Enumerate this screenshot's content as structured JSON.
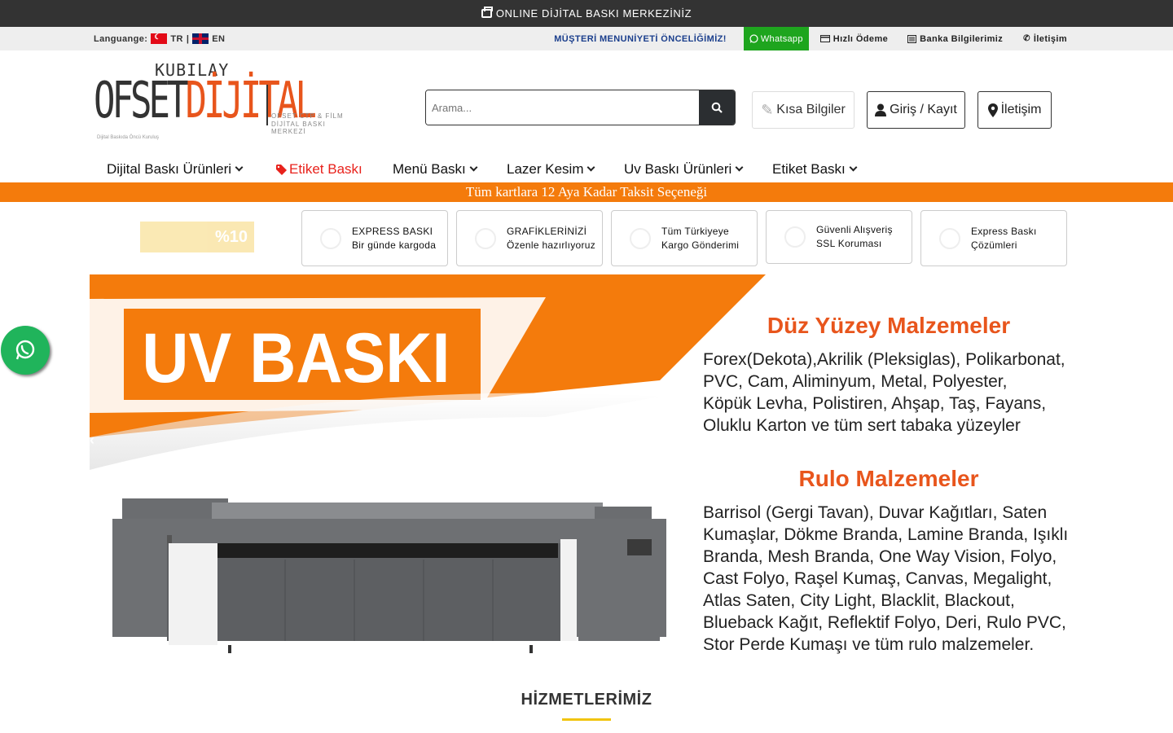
{
  "topbar": {
    "text": "ONLINE DİJİTAL BASKI MERKEZİNİZ",
    "icon": "printer-icon"
  },
  "subbar": {
    "language_label": "Languange:",
    "lang_tr": "TR",
    "lang_sep": "|",
    "lang_en": "EN",
    "slogan": "MÜŞTERİ MENUNİYETİ ÖNCELİĞİMİZ!",
    "whatsapp": "Whatsapp",
    "fast_pay": "Hızlı Ödeme",
    "bank": "Banka Bilgilerimiz",
    "contact": "İletişim"
  },
  "logo": {
    "top": "KUBILAY",
    "main_a": "OFSET",
    "main_b": "DİJİTAL",
    "sub1": "OFSET CTP & FİLM",
    "sub2": "DİJİTAL BASKI MERKEZİ",
    "tagline": "Dijital Baskıda Öncü Kuruluş"
  },
  "search": {
    "placeholder": "Arama..."
  },
  "header_buttons": {
    "info": "Kısa Bilgiler",
    "login": "Giriş / Kayıt",
    "contact": "İletişim"
  },
  "nav": [
    {
      "label": "Dijital Baskı Ürünleri"
    },
    {
      "label": "Etiket Baskı"
    },
    {
      "label": "Menü Baskı"
    },
    {
      "label": "Lazer Kesim"
    },
    {
      "label": "Uv Baskı Ürünleri"
    },
    {
      "label": "Etiket Baskı"
    }
  ],
  "promo": "Tüm kartlara 12 Aya Kadar Taksit Seçeneği",
  "badge": "%10",
  "features": [
    {
      "line1": "EXPRESS BASKI",
      "line2": "Bir günde kargoda"
    },
    {
      "line1": "GRAFİKLERİNİZİ",
      "line2": "Özenle hazırlıyoruz"
    },
    {
      "line1": "Tüm Türkiyeye",
      "line2": "Kargo Gönderimi"
    },
    {
      "line1": "Güvenli Alışveriş",
      "line2": "SSL Koruması"
    },
    {
      "line1": "Express Baskı",
      "line2": "Çözümleri"
    }
  ],
  "banner": {
    "title": "UV BASKI",
    "flat_title": "Düz Yüzey Malzemeler",
    "flat_lines": [
      "Forex(Dekota),Akrilik (Pleksiglas), Polikarbonat,",
      "PVC, Cam, Aliminyum, Metal, Polyester,",
      "Köpük Levha, Polistiren, Ahşap, Taş, Fayans,",
      "Oluklu Karton ve tüm sert tabaka yüzeyler"
    ],
    "roll_title": "Rulo Malzemeler",
    "roll_lines": [
      "Barrisol (Gergi Tavan), Duvar Kağıtları, Saten",
      "Kumaşlar, Dökme Branda, Lamine Branda, Işıklı",
      "Branda, Mesh Branda, One Way Vision, Folyo,",
      "Cast Folyo, Raşel Kumaş, Canvas, Megalight,",
      "Atlas Saten, City Light, Blacklit, Blackout,",
      "Blueback Kağıt, Reflektif Folyo, Deri, Rulo PVC,",
      "Stor Perde Kumaşı ve tüm rulo malzemeler."
    ]
  },
  "section_title": "HİZMETLERİMİZ",
  "colors": {
    "accent": "#f47b0c",
    "dark": "#333333",
    "whatsapp": "#1ea51e",
    "nav_red": "#e8221c",
    "slogan": "#1a3e8c"
  }
}
